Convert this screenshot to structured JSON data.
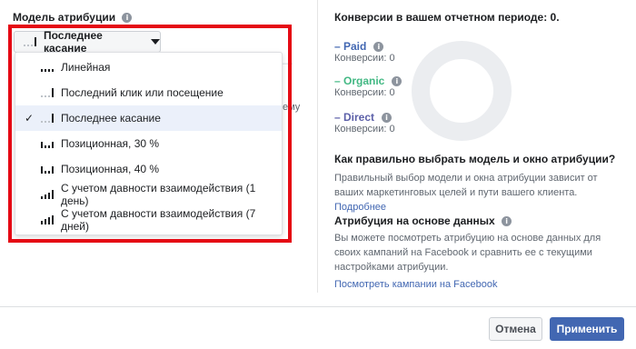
{
  "left": {
    "title": "Модель атрибуции",
    "selected_label": "Последнее касание",
    "menu_items": [
      {
        "label": "Линейная",
        "bars": [
          3,
          3,
          3,
          3
        ],
        "light": 0,
        "selected": false
      },
      {
        "label": "Последний клик или посещение",
        "bars": [
          3,
          3,
          3,
          10
        ],
        "light": 3,
        "selected": false
      },
      {
        "label": "Последнее касание",
        "bars": [
          3,
          3,
          3,
          10
        ],
        "light": 3,
        "selected": true
      },
      {
        "label": "Позиционная, 30 %",
        "bars": [
          6,
          3,
          3,
          6
        ],
        "light": 0,
        "selected": false
      },
      {
        "label": "Позиционная, 40 %",
        "bars": [
          7,
          3,
          3,
          7
        ],
        "light": 0,
        "selected": false
      },
      {
        "label": "С учетом давности взаимодействия (1 день)",
        "bars": [
          3,
          5,
          7,
          10
        ],
        "light": 0,
        "selected": false
      },
      {
        "label": "С учетом давности взаимодействия (7 дней)",
        "bars": [
          4,
          6,
          8,
          10
        ],
        "light": 0,
        "selected": false
      }
    ],
    "check_mark": "✓",
    "behind_fragment": "ему"
  },
  "right": {
    "conversions_title": "Конверсии в вашем отчетном периоде: 0.",
    "legend": [
      {
        "label": "– Paid",
        "sub": "Конверсии: 0",
        "color": "#4267b2"
      },
      {
        "label": "– Organic",
        "sub": "Конверсии: 0",
        "color": "#42b883"
      },
      {
        "label": "– Direct",
        "sub": "Конверсии: 0",
        "color": "#5b5fa8"
      }
    ],
    "donut_color": "#ebedf0",
    "how_title": "Как правильно выбрать модель и окно атрибуции?",
    "how_text": "Правильный выбор модели и окна атрибуции зависит от ваших маркетинговых целей и пути вашего клиента.",
    "how_link": "Подробнее",
    "data_title": "Атрибуция на основе данных",
    "data_text": "Вы можете посмотреть атрибуцию на основе данных для своих кампаний на Facebook и сравнить ее с текущими настройками атрибуции.",
    "data_link": "Посмотреть кампании на Facebook"
  },
  "footer": {
    "cancel": "Отмена",
    "apply": "Применить"
  },
  "info_glyph": "i",
  "frame_color": "#e50914"
}
